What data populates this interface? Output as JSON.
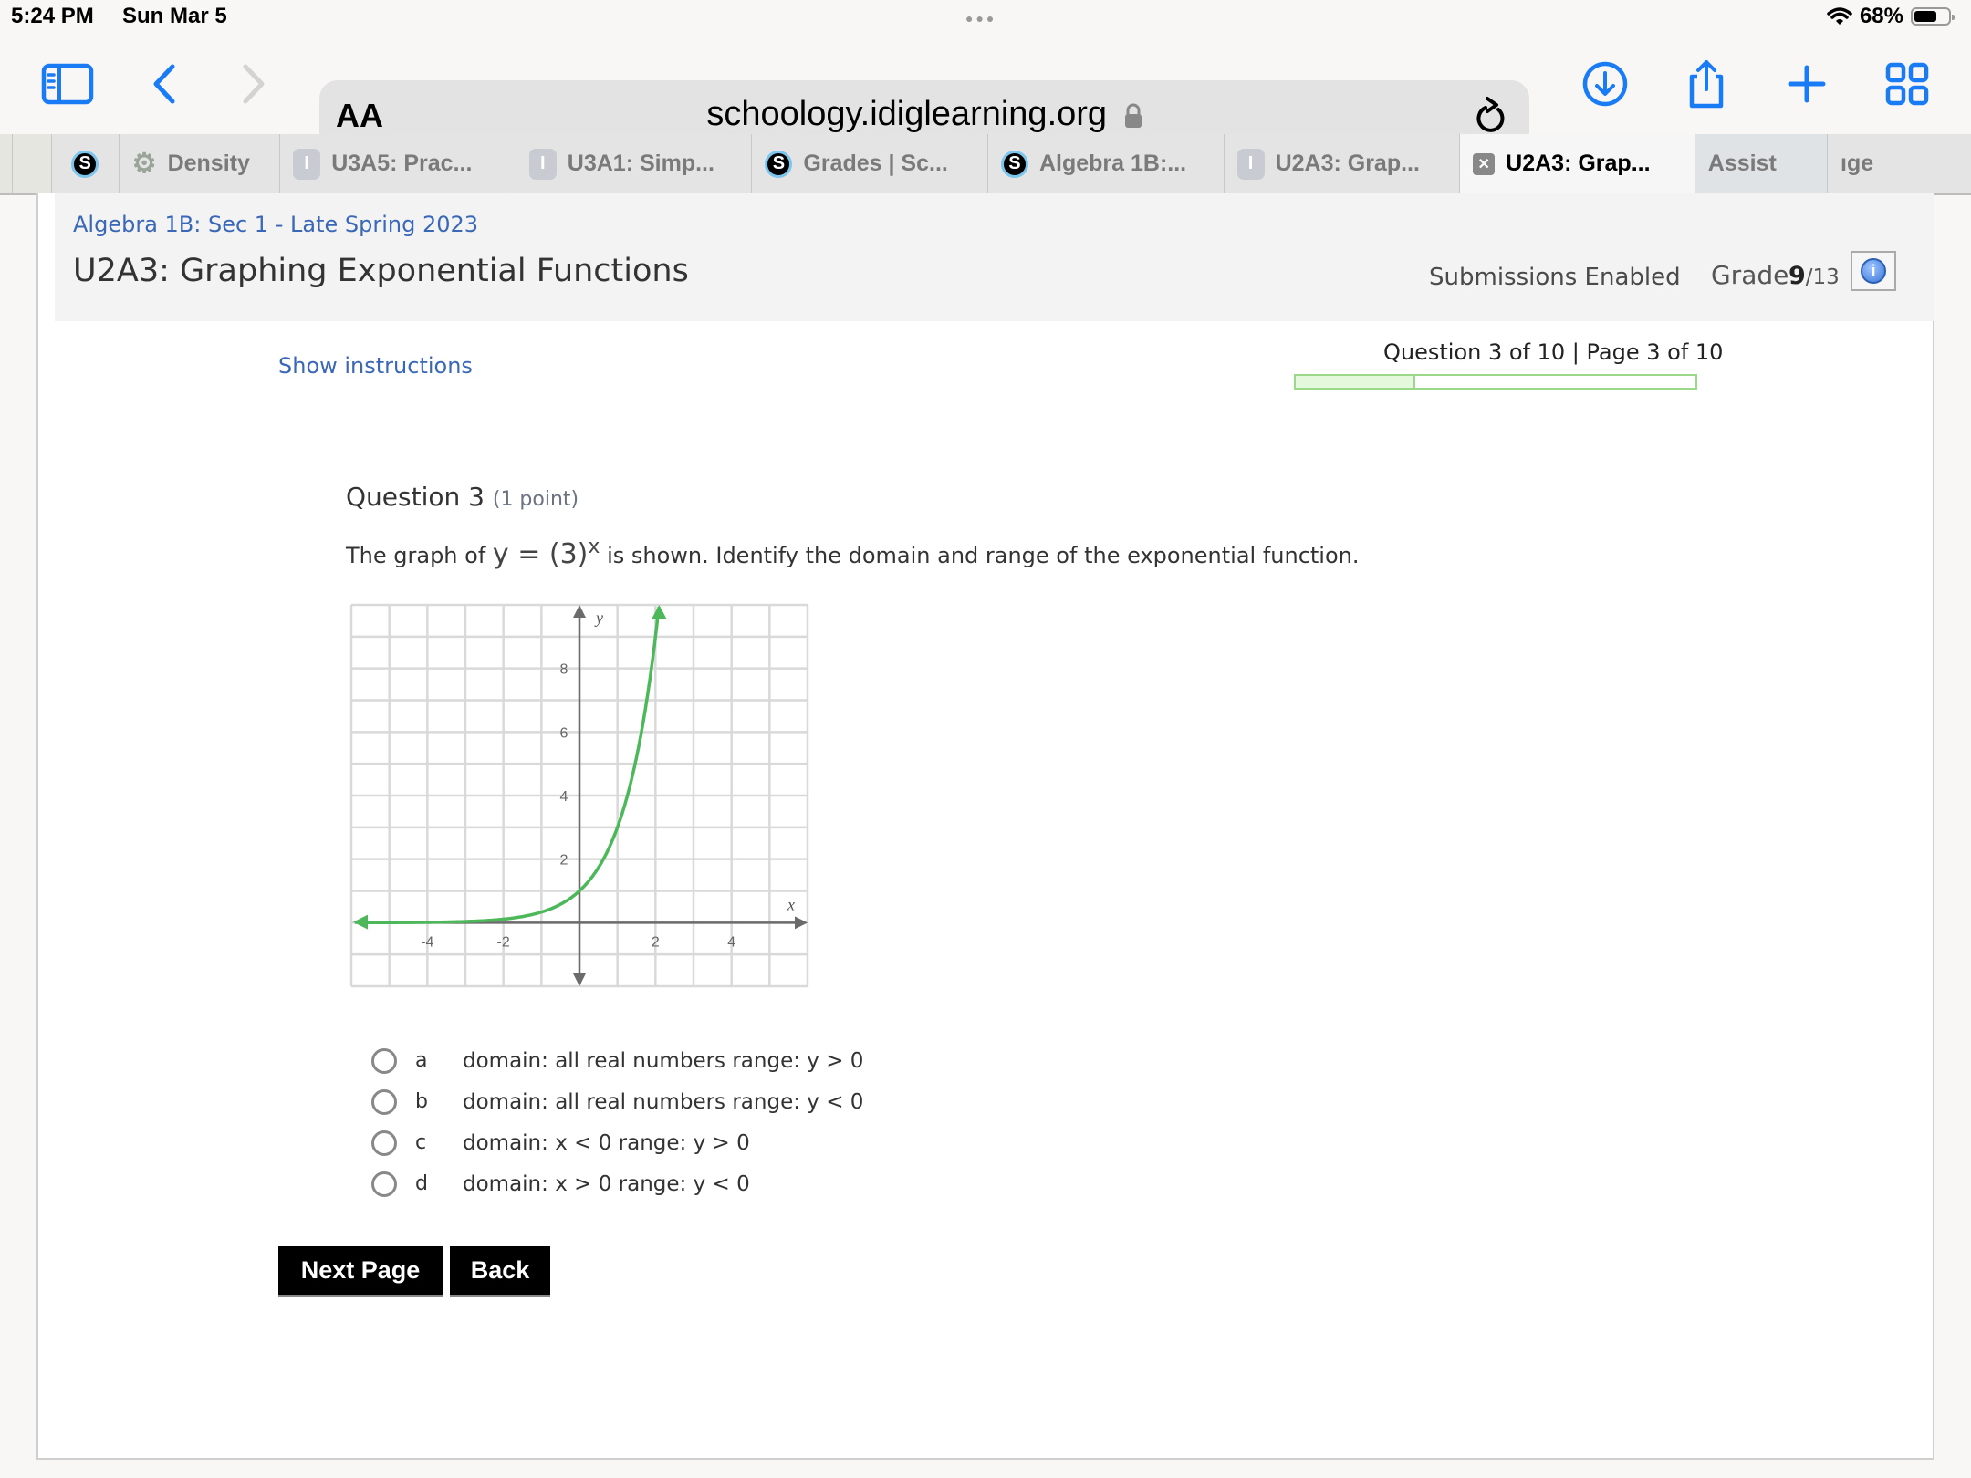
{
  "status_bar": {
    "time": "5:24 PM",
    "date": "Sun Mar 5",
    "battery_percent": "68%",
    "battery_level": 0.68,
    "icons": [
      "wifi-icon",
      "battery-icon"
    ]
  },
  "browser": {
    "text_size_button": "AA",
    "url": "schoology.idiglearning.org",
    "icons": [
      "sidebar-icon",
      "back-icon",
      "forward-icon",
      "lock-icon",
      "reload-icon",
      "download-icon",
      "share-icon",
      "new-tab-icon",
      "tab-overview-icon"
    ],
    "tabs": [
      {
        "label": "",
        "favicon": "schoology-icon"
      },
      {
        "label": "Density",
        "favicon": "gear-icon"
      },
      {
        "label": "U3A5: Prac...",
        "favicon": "idig-icon"
      },
      {
        "label": "U3A1: Simp...",
        "favicon": "idig-icon"
      },
      {
        "label": "Grades | Sc...",
        "favicon": "schoology-icon"
      },
      {
        "label": "Algebra 1B:...",
        "favicon": "schoology-icon"
      },
      {
        "label": "U2A3: Grap...",
        "favicon": "idig-icon"
      },
      {
        "label": "U2A3: Grap...",
        "favicon": "close-icon",
        "active": true
      },
      {
        "label": "Assist",
        "favicon": ""
      },
      {
        "label": "ıge",
        "favicon": ""
      }
    ]
  },
  "header": {
    "breadcrumb": "Algebra 1B: Sec 1 - Late Spring 2023",
    "title": "U2A3: Graphing Exponential Functions",
    "submissions": "Submissions Enabled",
    "grade_label": "Grade:",
    "grade_score": "9",
    "grade_total": "/13"
  },
  "assessment": {
    "show_instructions": "Show instructions",
    "progress_text": "Question 3 of 10 | Page 3 of 10",
    "progress_fraction": 0.3,
    "question_label": "Question 3",
    "question_points": "(1 point)",
    "prompt_before": "The graph of",
    "equation_lhs": "y = (3)",
    "equation_exp": "x",
    "prompt_after": "is shown. Identify the domain and range of the exponential function.",
    "choices": [
      {
        "letter": "a",
        "text": "domain: all real numbers range: y > 0"
      },
      {
        "letter": "b",
        "text": "domain: all real numbers range: y < 0"
      },
      {
        "letter": "c",
        "text": "domain: x < 0 range: y > 0"
      },
      {
        "letter": "d",
        "text": "domain: x > 0 range: y < 0"
      }
    ],
    "next_button": "Next Page",
    "back_button": "Back"
  },
  "chart_data": {
    "type": "line",
    "function": "y = 3^x",
    "x_range": [
      -6,
      6
    ],
    "y_range": [
      -2,
      10
    ],
    "grid": true,
    "grid_step": 1,
    "x_ticks": [
      "-4",
      "-2",
      "2",
      "4"
    ],
    "x_tick_values": [
      -4,
      -2,
      2,
      4
    ],
    "y_ticks": [
      "2",
      "4",
      "6",
      "8"
    ],
    "y_tick_values": [
      2,
      4,
      6,
      8
    ],
    "xlabel": "x",
    "ylabel": "y",
    "line_color": "#4cb85a",
    "series": [
      {
        "name": "y = 3^x",
        "x": [
          -6,
          -4,
          -2,
          -1,
          0,
          1,
          1.5,
          2,
          2.1
        ],
        "y": [
          0.0014,
          0.012,
          0.111,
          0.333,
          1,
          3,
          5.196,
          9,
          10
        ]
      }
    ]
  }
}
